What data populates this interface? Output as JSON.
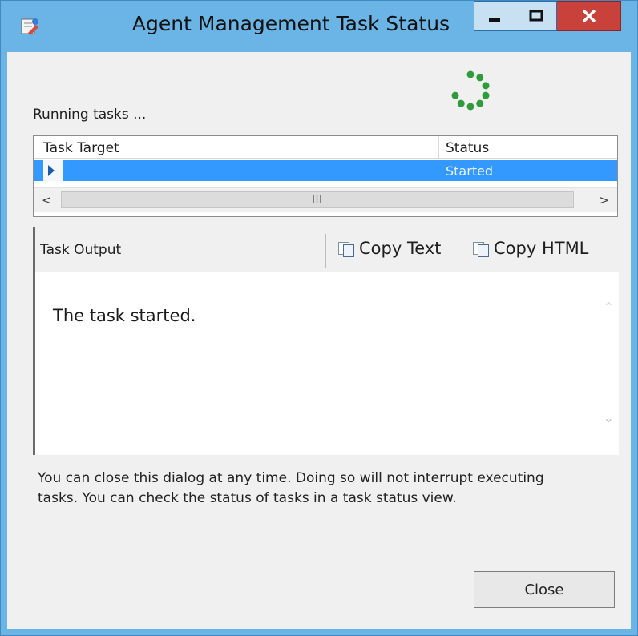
{
  "window": {
    "title": "Agent Management Task Status",
    "minimize_label": "—",
    "maximize_label": "□",
    "close_label": "✕"
  },
  "status_text": "Running tasks ...",
  "grid": {
    "columns": [
      "Task Target",
      "Status"
    ],
    "rows": [
      {
        "target": "",
        "status": "Started"
      }
    ],
    "scroll_left": "<",
    "scroll_right": ">",
    "scroll_thumb": "III"
  },
  "output": {
    "label": "Task Output",
    "copy_text_label": "Copy Text",
    "copy_html_label": "Copy HTML",
    "text": "The task started."
  },
  "info_text": "You can close this dialog at any time. Doing so will not interrupt executing tasks. You can check the status of tasks in a task status view.",
  "close_button_label": "Close",
  "colors": {
    "title_bar": "#6bb5e6",
    "selection": "#3399ff",
    "close_button": "#c8413b",
    "spinner": "#2e9c3a"
  },
  "icons": [
    "app-icon",
    "minimize-icon",
    "maximize-icon",
    "close-icon",
    "spinner-icon",
    "copy-icon"
  ]
}
